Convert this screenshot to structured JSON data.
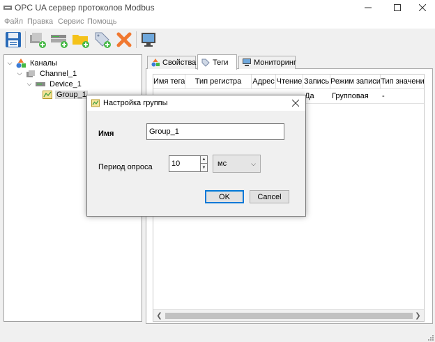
{
  "window": {
    "title": "OPC UA сервер протоколов Modbus"
  },
  "icons": {
    "app": "app-network-icon",
    "save": "save-disk-icon",
    "add_channel": "add-channel-icon",
    "add_device": "add-device-icon",
    "add_group": "add-group-folder-icon",
    "add_tag": "add-tag-icon",
    "delete": "delete-x-icon",
    "monitor": "monitor-icon"
  },
  "colors": {
    "accent": "#0078d7",
    "delete": "#f07830",
    "add": "#44b844"
  },
  "menu": [
    "Файл",
    "Правка",
    "Сервис",
    "Помощь"
  ],
  "tree": {
    "root": "Каналы",
    "channel": "Channel_1",
    "device": "Device_1",
    "group": "Group_1"
  },
  "tabs": [
    "Свойства",
    "Теги",
    "Мониторинг"
  ],
  "grid": {
    "headers": [
      "Имя тега",
      "Тип регистра",
      "Адрес",
      "Чтение",
      "Запись",
      "Режим записи",
      "Тип значения"
    ],
    "row": [
      "",
      "",
      "",
      "",
      "Да",
      "Групповая",
      "-"
    ]
  },
  "dialog": {
    "title": "Настройка группы",
    "name_label": "Имя",
    "name_value": "Group_1",
    "period_label": "Период опроса",
    "period_value": "10",
    "unit": "мс",
    "ok": "OK",
    "cancel": "Cancel"
  }
}
